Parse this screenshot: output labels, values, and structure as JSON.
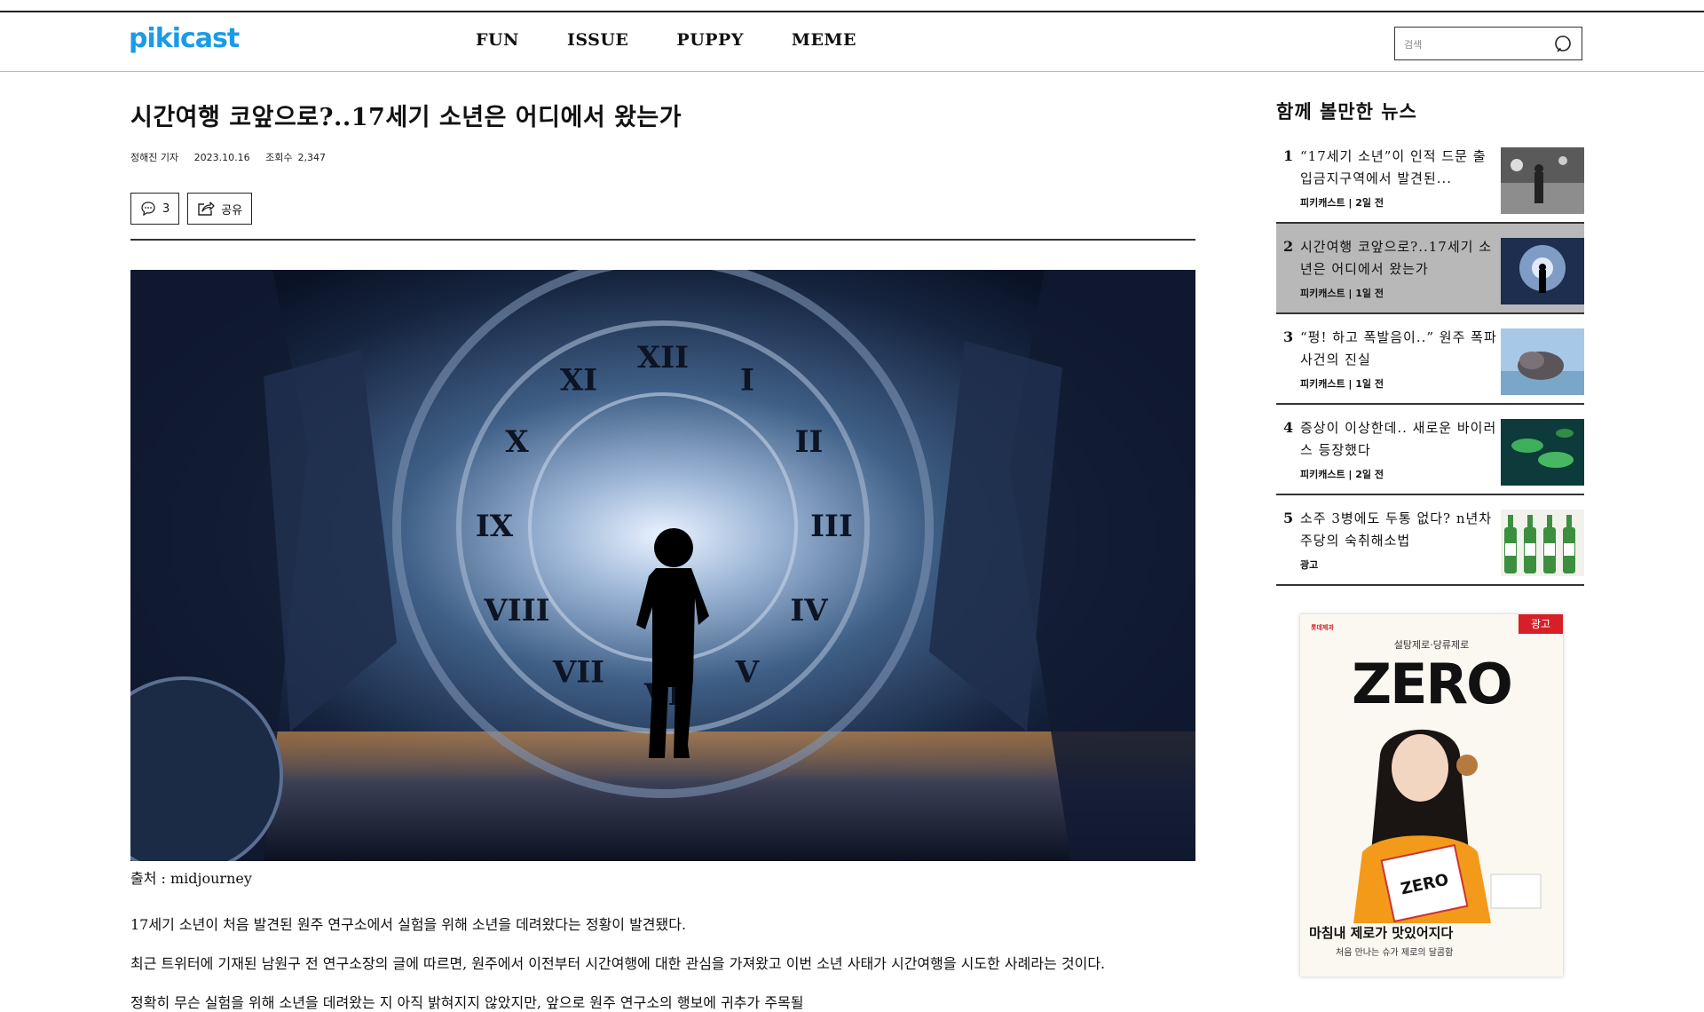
{
  "header": {
    "logo": "pikicast",
    "nav": [
      "FUN",
      "ISSUE",
      "PUPPY",
      "MEME"
    ],
    "search_placeholder": "검색"
  },
  "article": {
    "title": "시간여행 코앞으로?..17세기 소년은 어디에서 왔는가",
    "author": "정해진 기자",
    "date": "2023.10.16",
    "views_label": "조회수",
    "views": "2,347",
    "comment_count": "3",
    "share_label": "공유",
    "image_caption": "출처 : midjourney",
    "hero_numerals": [
      "XII",
      "I",
      "II",
      "III",
      "IV",
      "V",
      "VI",
      "VII",
      "VIII",
      "IX",
      "X",
      "XI"
    ],
    "paragraphs": [
      "17세기 소년이 처음 발견된 원주 연구소에서 실험을 위해 소년을 데려왔다는 정황이 발견됐다.",
      "최근 트위터에 기재된 남원구 전 연구소장의 글에 따르면, 원주에서 이전부터 시간여행에 대한 관심을 가져왔고 이번 소년 사태가 시간여행을 시도한 사례라는 것이다.",
      "정확히 무슨 실험을 위해 소년을 데려왔는 지 아직 밝혀지지 않았지만, 앞으로 원주 연구소의 행보에 귀추가 주목될"
    ]
  },
  "sidebar": {
    "title": "함께 볼만한 뉴스",
    "items": [
      {
        "num": "1",
        "headline": "“17세기 소년”이 인적 드문 출입금지구역에서 발견된...",
        "source": "피키캐스트 | 2일 전"
      },
      {
        "num": "2",
        "headline": "시간여행 코앞으로?..17세기 소년은 어디에서 왔는가",
        "source": "피키캐스트 | 1일 전"
      },
      {
        "num": "3",
        "headline": "“펑! 하고 폭발음이..” 원주 폭파사건의 진실",
        "source": "피키캐스트 | 1일 전"
      },
      {
        "num": "4",
        "headline": "증상이 이상한데.. 새로운 바이러스 등장했다",
        "source": "피키캐스트 | 2일 전"
      },
      {
        "num": "5",
        "headline": "소주 3병에도 두통 없다? n년차 주당의 숙취해소법",
        "source": "광고"
      }
    ],
    "ad": {
      "badge": "광고",
      "brand": "롯데제과",
      "subtitle": "설탕제로·당류제로",
      "headline": "ZERO",
      "slogan": "마침내 제로가 맛있어지다",
      "slogan2": "처음 만나는 슈가 제로의 달콤함"
    }
  }
}
